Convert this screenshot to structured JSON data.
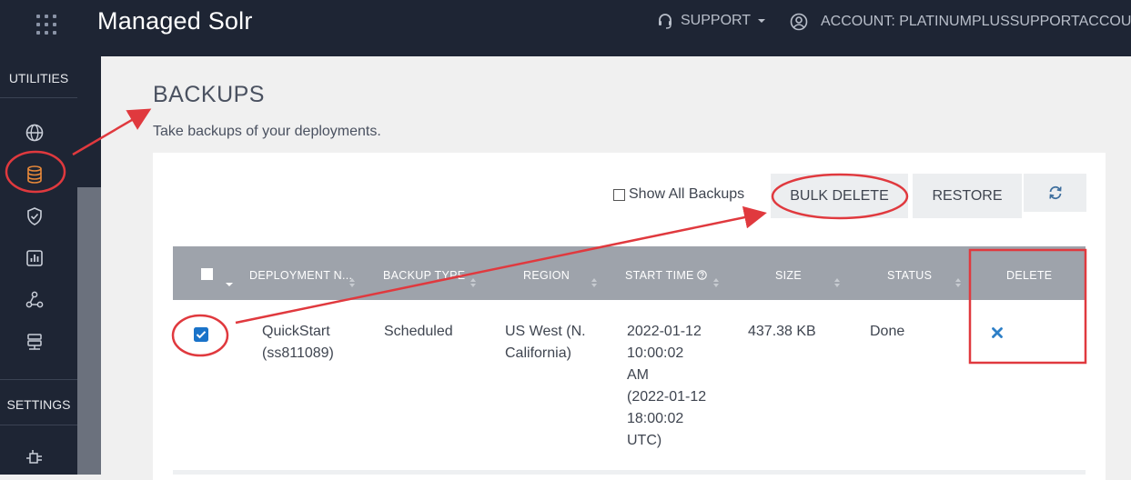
{
  "header": {
    "app_title": "Managed Solr",
    "support_label": "SUPPORT",
    "account_label": "ACCOUNT: PLATINUMPLUSSUPPORTACCOUNT",
    "icons": [
      "apps-grid-icon",
      "headset-icon",
      "caret-down-icon",
      "user-circle-icon"
    ]
  },
  "sidebar": {
    "utilities_label": "UTILITIES",
    "settings_label": "SETTINGS",
    "items": [
      {
        "icon": "globe-icon"
      },
      {
        "icon": "database-icon",
        "active": true
      },
      {
        "icon": "shield-check-icon"
      },
      {
        "icon": "chart-icon"
      },
      {
        "icon": "network-icon"
      },
      {
        "icon": "server-icon"
      },
      {
        "icon": "plug-icon"
      }
    ]
  },
  "page": {
    "title": "BACKUPS",
    "subtitle": "Take backups of your deployments."
  },
  "toolbar": {
    "show_all_label": "Show All Backups",
    "bulk_delete_label": "BULK DELETE",
    "restore_label": "RESTORE",
    "refresh_icon": "refresh-icon"
  },
  "table": {
    "columns": [
      "DEPLOYMENT N...",
      "BACKUP TYPE",
      "REGION",
      "START TIME",
      "SIZE",
      "STATUS",
      "DELETE"
    ],
    "rows": [
      {
        "selected": true,
        "deployment": [
          "QuickStart",
          "(ss811089)"
        ],
        "backup_type": "Scheduled",
        "region": [
          "US West (N.",
          "California)"
        ],
        "start_time": [
          "2022-01-12",
          "10:00:02",
          "AM",
          "(2022-01-12",
          "18:00:02",
          "UTC)"
        ],
        "size": "437.38 KB",
        "status": "Done",
        "delete_icon": "delete-x-icon"
      }
    ]
  },
  "colors": {
    "topbar": "#1e2534",
    "accent_orange": "#e8893a",
    "annotation_red": "#e0393e",
    "checkbox_blue": "#1a73c9",
    "delete_blue": "#2d7fc7",
    "table_header": "#9ea3ab"
  }
}
